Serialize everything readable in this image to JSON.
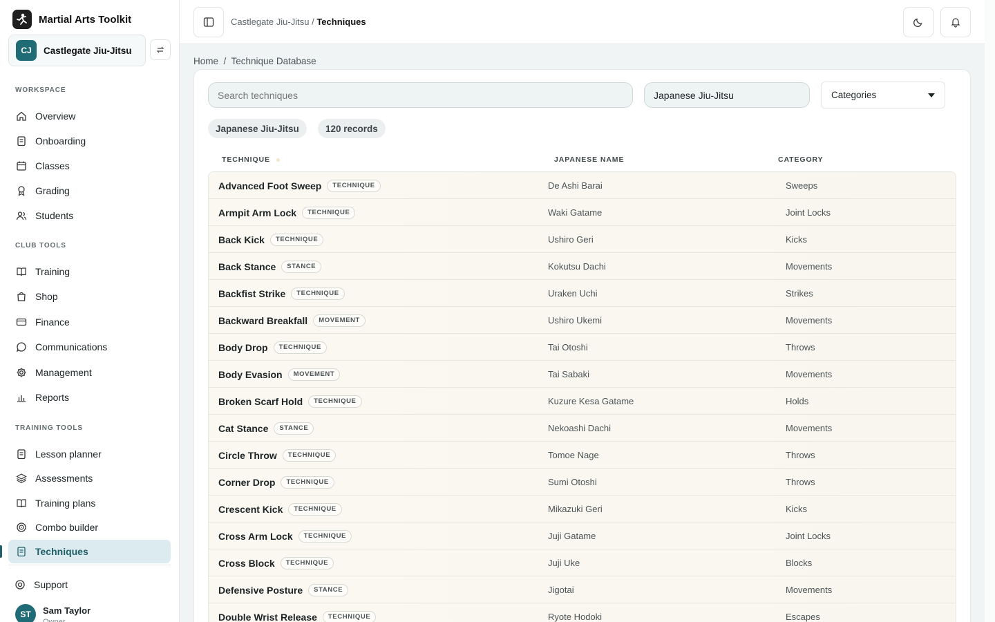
{
  "app": {
    "title": "Martial Arts Toolkit"
  },
  "club": {
    "initials": "CJ",
    "name": "Castlegate Jiu-Jitsu"
  },
  "sidebar": {
    "workspace_label": "WORKSPACE",
    "workspace": [
      {
        "label": "Overview",
        "icon": "home-icon"
      },
      {
        "label": "Onboarding",
        "icon": "clipboard-icon"
      },
      {
        "label": "Classes",
        "icon": "calendar-icon"
      },
      {
        "label": "Grading",
        "icon": "award-icon"
      },
      {
        "label": "Students",
        "icon": "users-icon"
      }
    ],
    "club_tools_label": "CLUB TOOLS",
    "club_tools": [
      {
        "label": "Training",
        "icon": "book-open-icon"
      },
      {
        "label": "Shop",
        "icon": "shopping-bag-icon"
      },
      {
        "label": "Finance",
        "icon": "credit-card-icon"
      },
      {
        "label": "Communications",
        "icon": "message-circle-icon"
      },
      {
        "label": "Management",
        "icon": "gear-icon"
      },
      {
        "label": "Reports",
        "icon": "bar-chart-icon"
      }
    ],
    "training_tools_label": "TRAINING TOOLS",
    "training_tools": [
      {
        "label": "Lesson planner",
        "icon": "clipboard-icon"
      },
      {
        "label": "Assessments",
        "icon": "layers-icon"
      },
      {
        "label": "Training plans",
        "icon": "book-open-icon"
      },
      {
        "label": "Combo builder",
        "icon": "target-icon"
      },
      {
        "label": "Techniques",
        "icon": "clipboard-icon",
        "active": true
      }
    ],
    "support_label": "Support"
  },
  "user": {
    "initials": "ST",
    "name": "Sam Taylor",
    "role": "Owner"
  },
  "topbar": {
    "crumb_club": "Castlegate Jiu-Jitsu",
    "crumb_sep": "/",
    "crumb_page": "Techniques"
  },
  "page": {
    "breadcrumb": "Home  /  Technique Database",
    "search_placeholder": "Search techniques",
    "style_value": "Japanese Jiu-Jitsu",
    "categories_label": "Categories",
    "chip_style": "Japanese Jiu-Jitsu",
    "chip_count": "120 records"
  },
  "table": {
    "columns": [
      "TECHNIQUE",
      "JAPANESE NAME",
      "CATEGORY"
    ],
    "rows": [
      {
        "name": "Advanced Foot Sweep",
        "type": "TECHNIQUE",
        "jp": "De Ashi Barai",
        "cat": "Sweeps"
      },
      {
        "name": "Armpit Arm Lock",
        "type": "TECHNIQUE",
        "jp": "Waki Gatame",
        "cat": "Joint Locks"
      },
      {
        "name": "Back Kick",
        "type": "TECHNIQUE",
        "jp": "Ushiro Geri",
        "cat": "Kicks"
      },
      {
        "name": "Back Stance",
        "type": "STANCE",
        "jp": "Kokutsu Dachi",
        "cat": "Movements"
      },
      {
        "name": "Backfist Strike",
        "type": "TECHNIQUE",
        "jp": "Uraken Uchi",
        "cat": "Strikes"
      },
      {
        "name": "Backward Breakfall",
        "type": "MOVEMENT",
        "jp": "Ushiro Ukemi",
        "cat": "Movements"
      },
      {
        "name": "Body Drop",
        "type": "TECHNIQUE",
        "jp": "Tai Otoshi",
        "cat": "Throws"
      },
      {
        "name": "Body Evasion",
        "type": "MOVEMENT",
        "jp": "Tai Sabaki",
        "cat": "Movements"
      },
      {
        "name": "Broken Scarf Hold",
        "type": "TECHNIQUE",
        "jp": "Kuzure Kesa Gatame",
        "cat": "Holds"
      },
      {
        "name": "Cat Stance",
        "type": "STANCE",
        "jp": "Nekoashi Dachi",
        "cat": "Movements"
      },
      {
        "name": "Circle Throw",
        "type": "TECHNIQUE",
        "jp": "Tomoe Nage",
        "cat": "Throws"
      },
      {
        "name": "Corner Drop",
        "type": "TECHNIQUE",
        "jp": "Sumi Otoshi",
        "cat": "Throws"
      },
      {
        "name": "Crescent Kick",
        "type": "TECHNIQUE",
        "jp": "Mikazuki Geri",
        "cat": "Kicks"
      },
      {
        "name": "Cross Arm Lock",
        "type": "TECHNIQUE",
        "jp": "Juji Gatame",
        "cat": "Joint Locks"
      },
      {
        "name": "Cross Block",
        "type": "TECHNIQUE",
        "jp": "Juji Uke",
        "cat": "Blocks"
      },
      {
        "name": "Defensive Posture",
        "type": "STANCE",
        "jp": "Jigotai",
        "cat": "Movements"
      },
      {
        "name": "Double Wrist Release",
        "type": "TECHNIQUE",
        "jp": "Ryote Hodoki",
        "cat": "Escapes"
      }
    ]
  },
  "colors": {
    "accent": "#1e5f6a",
    "active_bg": "#dcebef",
    "row_bg": "#fbf8f1"
  }
}
